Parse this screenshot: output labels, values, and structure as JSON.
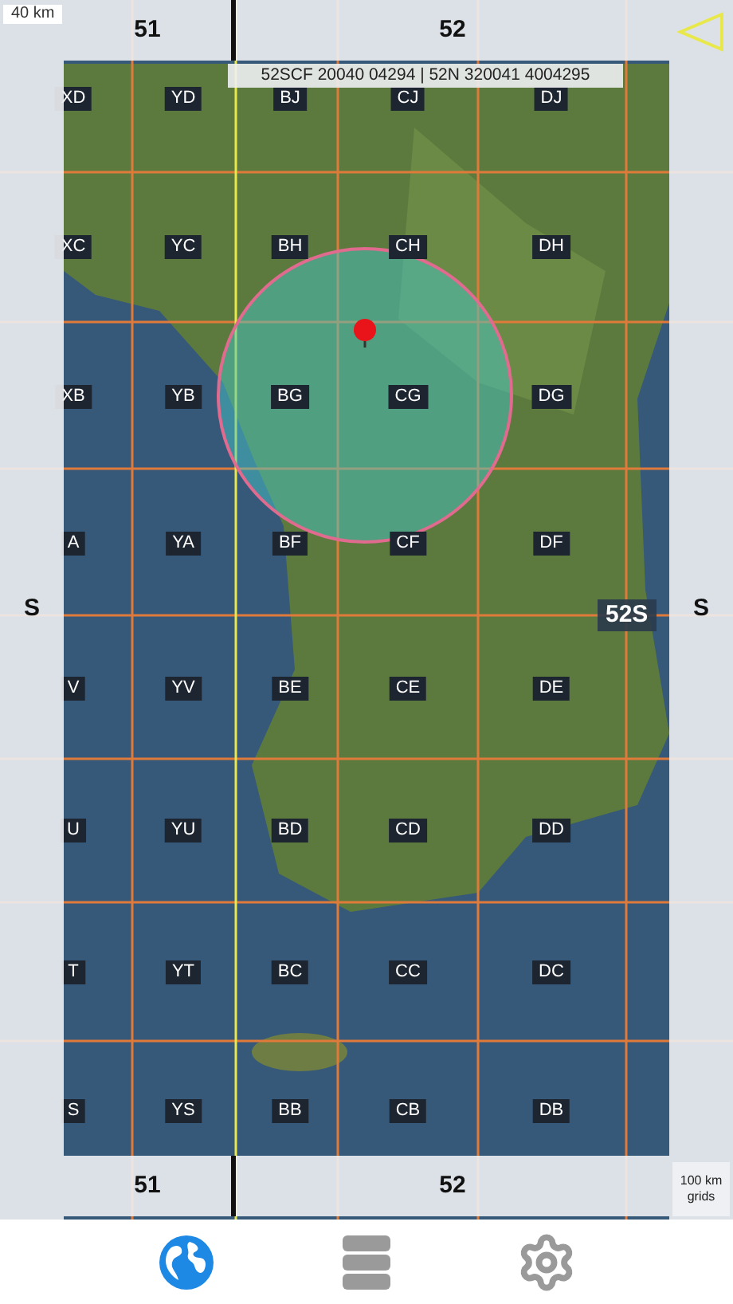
{
  "scale": "40 km",
  "top_zones": [
    {
      "label": "51"
    },
    {
      "label": "52"
    }
  ],
  "bottom_zones": [
    {
      "label": "51"
    },
    {
      "label": "52"
    }
  ],
  "coordinates": "52SCF 20040 04294 | 52N 320041 4004295",
  "side_labels": [
    "S",
    "S"
  ],
  "zone_label": "52S",
  "grid_labels": [
    [
      "XD",
      "YD",
      "BJ",
      "CJ",
      "DJ"
    ],
    [
      "XC",
      "YC",
      "BH",
      "CH",
      "DH"
    ],
    [
      "XB",
      "YB",
      "BG",
      "CG",
      "DG"
    ],
    [
      "A",
      "YA",
      "BF",
      "CF",
      "DF"
    ],
    [
      "V",
      "YV",
      "BE",
      "CE",
      "DE"
    ],
    [
      "U",
      "YU",
      "BD",
      "CD",
      "DD"
    ],
    [
      "T",
      "YT",
      "BC",
      "CC",
      "DC"
    ],
    [
      "S",
      "YS",
      "BB",
      "CB",
      "DB"
    ]
  ],
  "grids_button": "100 km grids",
  "tabs": [
    {
      "kind": "map",
      "selected": true
    },
    {
      "kind": "list",
      "selected": false
    },
    {
      "kind": "settings",
      "selected": false
    }
  ]
}
